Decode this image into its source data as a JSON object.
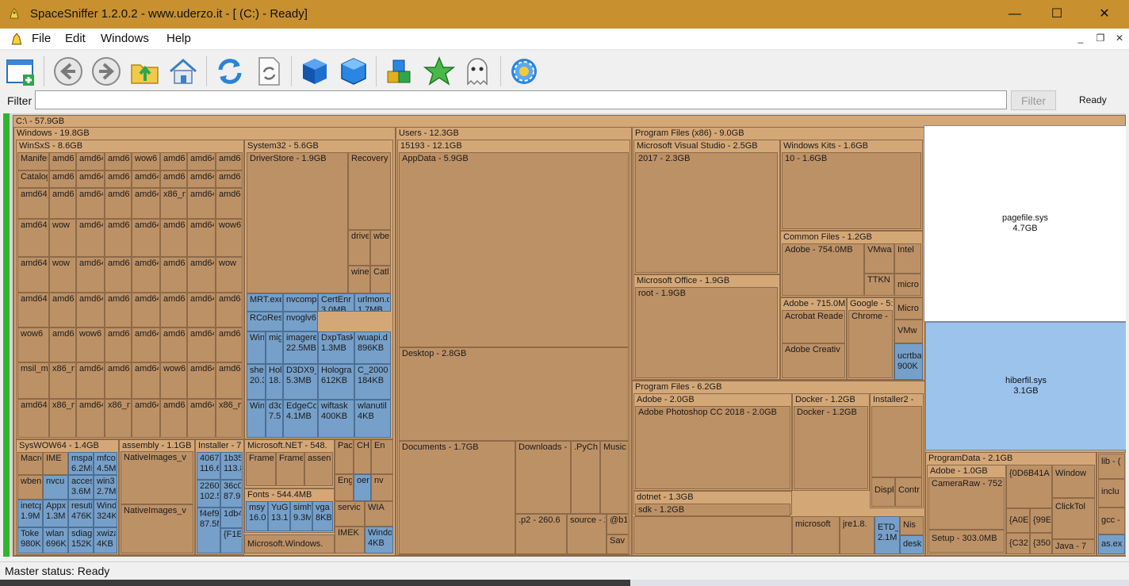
{
  "window": {
    "title": "SpaceSniffer 1.2.0.2 - www.uderzo.it - [ (C:) - Ready]",
    "minimize_glyph": "—",
    "maximize_glyph": "☐",
    "close_glyph": "✕"
  },
  "menu": {
    "items": [
      "File",
      "Edit",
      "Windows",
      "Help"
    ],
    "mdi_minimize": "_",
    "mdi_restore": "❐",
    "mdi_close": "✕"
  },
  "toolbar": {
    "icons": [
      "new-view-icon",
      "back-icon",
      "forward-icon",
      "folder-up-icon",
      "home-icon",
      "refresh-icon",
      "refresh-document-icon",
      "blue-cube-icon",
      "blue-cube-outline-icon",
      "cubes-icon",
      "star-icon",
      "ghost-icon",
      "gear-flower-icon"
    ]
  },
  "filter": {
    "label": "Filter",
    "value": "",
    "button": "Filter",
    "status": "Ready"
  },
  "colors": {
    "title_bar": "#c8902f",
    "block": "#d4a777",
    "file_block": "#76a0c9",
    "highlight_green": "#2fb52f",
    "hiberfil": "#9cc3ec"
  },
  "treemap": {
    "root": "C:\\ - 57.9GB",
    "windows": {
      "label": "Windows - 19.8GB",
      "winsxs": {
        "label": "WinSxS - 8.6GB",
        "cells": [
          "Manifes",
          "amd6",
          "amd64",
          "amd64",
          "wow6",
          "amd64",
          "amd64",
          "amd64",
          "Catalog",
          "amd6",
          "amd64",
          "amd64",
          "amd64",
          "amd64",
          "amd64",
          "amd64",
          "amd64_",
          "amd6",
          "amd64",
          "amd64",
          "amd64",
          "x86_m",
          "amd64",
          "amd64",
          "amd64_",
          "wow",
          "amd64",
          "amd6",
          "amd64",
          "amd64",
          "amd64",
          "wow6",
          "amd64",
          "wow",
          "amd64",
          "amd64",
          "amd64",
          "amd64",
          "amd64",
          "wow",
          "amd64",
          "amd64",
          "amd64",
          "amd64",
          "amd64",
          "amd64",
          "amd64",
          "amd64",
          "wow6",
          "amd64",
          "wow6",
          "amd64",
          "amd64",
          "amd64",
          "amd64",
          "amd64",
          "msil_m",
          "x86_m",
          "amd64",
          "amd64",
          "amd64",
          "wow6",
          "amd64",
          "amd64",
          "amd64",
          "x86_m",
          "amd64",
          "x86_m",
          "amd64",
          "amd64",
          "amd64",
          "x86_m"
        ]
      },
      "system32": {
        "label": "System32 - 5.6GB",
        "driverstore": "DriverStore - 1.9GB",
        "recovery": "Recovery",
        "cells": [
          "drive",
          "wbe",
          "wine",
          "Catl"
        ],
        "files": [
          [
            "MRT.exe",
            ""
          ],
          [
            "nvcomp",
            ""
          ],
          [
            "CertEnr",
            "3.0MB"
          ],
          [
            "urlmon.d",
            "1.7MB"
          ],
          [
            "RCoRes",
            ""
          ],
          [
            "nvoglv6",
            ""
          ],
          [
            "WinI",
            ""
          ],
          [
            "mig",
            ""
          ],
          [
            "imagere",
            "22.5MB"
          ],
          [
            "DxpTask",
            "1.3MB"
          ],
          [
            "wuapi.d",
            "896KB"
          ],
          [
            "shel",
            "20.3"
          ],
          [
            "Hol",
            "18.6"
          ],
          [
            "D3DX9_",
            "5.3MB"
          ],
          [
            "Hologra",
            "612KB"
          ],
          [
            "C_2000",
            "184KB"
          ],
          [
            "Win",
            ""
          ],
          [
            "d3d",
            "7.5I"
          ],
          [
            "EdgeCo",
            "4.1MB"
          ],
          [
            "wiftask",
            "400KB"
          ],
          [
            "wlanutil",
            "4KB"
          ]
        ]
      },
      "syswow64": {
        "label": "SysWOW64 - 1.4GB",
        "cells": [
          [
            "Macro",
            ""
          ],
          [
            "IME",
            ""
          ],
          [
            "mspa",
            "6.2MI"
          ],
          [
            "mfco",
            "4.5M"
          ],
          [
            "wben",
            ""
          ],
          [
            "nvcu",
            ""
          ],
          [
            "acces",
            "3.6M"
          ],
          [
            "win3",
            "2.7M"
          ],
          [
            "inetcp",
            "1.9M"
          ],
          [
            "Appx",
            "1.3M"
          ],
          [
            "resuti",
            "476K"
          ],
          [
            "Wind",
            "324K"
          ],
          [
            "Toke",
            "980K"
          ],
          [
            "wlan",
            "696K"
          ],
          [
            "sdiag",
            "152K"
          ],
          [
            "xwiza",
            "4KB"
          ]
        ]
      },
      "assembly": {
        "label": "assembly - 1.1GB",
        "cells": [
          "NativeImages_v",
          "NativeImages_v"
        ]
      },
      "installer": {
        "label": "Installer - 7",
        "cells": [
          [
            "4067",
            "116.6"
          ],
          [
            "1b35",
            "113.8"
          ],
          [
            "2260",
            "102.5"
          ],
          [
            "36c0",
            "87.9"
          ],
          [
            "1db4",
            ""
          ],
          [
            "f4ef9",
            "87.5M"
          ],
          [
            "{F1E",
            ""
          ]
        ]
      },
      "dotnet": {
        "label": "Microsoft.NET - 548.",
        "cells": [
          "Frame",
          "Frame",
          "assen"
        ]
      },
      "fonts": {
        "label": "Fonts - 544.4MB",
        "cells": [
          [
            "msy",
            "16.0"
          ],
          [
            "YuG",
            "13.1"
          ],
          [
            "simh",
            "9.3M"
          ],
          [
            "vga",
            "8KB"
          ]
        ]
      },
      "mswindows": "Microsoft.Windows.",
      "small": [
        [
          "Pac",
          ""
        ],
        [
          "CH",
          ""
        ],
        [
          "En",
          ""
        ],
        [
          "Eng",
          ""
        ],
        [
          "oer",
          ""
        ],
        [
          "nv",
          ""
        ],
        [
          "servic",
          ""
        ],
        [
          "WIA",
          ""
        ],
        [
          "IMEK",
          ""
        ],
        [
          "Windo",
          "4KB"
        ]
      ]
    },
    "users": {
      "label": "Users - 12.3GB",
      "user": "15193 - 12.1GB",
      "appdata": "AppData - 5.9GB",
      "desktop": "Desktop - 2.8GB",
      "documents": "Documents - 1.7GB",
      "downloads": "Downloads -",
      "pych": ".PyCh",
      "music": "Music",
      "p2": ".p2 - 260.6",
      "source": "source - 2",
      "b1": "@b1",
      "sav": "Sav"
    },
    "pfx86": {
      "label": "Program Files (x86) - 9.0GB",
      "vs": "Microsoft Visual Studio - 2.5GB",
      "vs2017": "2017 - 2.3GB",
      "kits": "Windows Kits - 1.6GB",
      "kits10": "10 - 1.6GB",
      "common": "Common Files - 1.2GB",
      "common_adobe": "Adobe - 754.0MB",
      "vmwa": "VMwa",
      "intel": "Intel",
      "ttkn": "TTKN",
      "micro": "micro",
      "office": "Microsoft Office - 1.9GB",
      "root": "root - 1.9GB",
      "adobe": "Adobe - 715.0M",
      "acrobat": "Acrobat Reade",
      "creative": "Adobe Creativ",
      "google": "Google - 5:",
      "chrome": "Chrome -",
      "micro2": "Micro",
      "vmw": "VMw",
      "ucrt": [
        "ucrtba",
        "900K"
      ]
    },
    "pf": {
      "label": "Program Files - 6.2GB",
      "adobe": "Adobe - 2.0GB",
      "photoshop": "Adobe Photoshop CC 2018 - 2.0GB",
      "docker": "Docker - 1.2GB",
      "docker2": "Docker - 1.2GB",
      "installer2": "Installer2 -",
      "displ": "Displ",
      "contr": "Contr",
      "dotnet": "dotnet - 1.3GB",
      "sdk": "sdk - 1.2GB",
      "microsoft": "microsoft",
      "jre": "jre1.8.",
      "etd": [
        "ETD_",
        "2.1M"
      ],
      "nis": "Nis",
      "desk": "desk"
    },
    "pagefile": {
      "name": "pagefile.sys",
      "size": "4.7GB"
    },
    "hiberfil": {
      "name": "hiberfil.sys",
      "size": "3.1GB"
    },
    "programdata": {
      "label": "ProgramData - 2.1GB",
      "adobe": "Adobe - 1.0GB",
      "cameraraw": "CameraRaw - 752",
      "setup": "Setup - 303.0MB",
      "guid": "{0D6B41A",
      "a0e": "{A0E",
      "99e": "{99E",
      "c32": "{C32",
      "350": "{350",
      "windows": "Window",
      "clicktol": "ClickTol",
      "java": "Java - 7",
      "lib": "lib - (",
      "inclu": "inclu",
      "gcc": "gcc -",
      "asex": "as.ex"
    }
  },
  "status": {
    "text": "Master status: Ready"
  }
}
